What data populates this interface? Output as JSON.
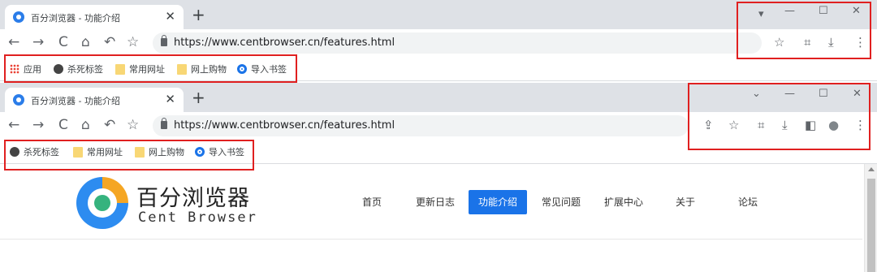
{
  "browser1": {
    "tab_title": "百分浏览器 - 功能介绍",
    "tab_close": "✕",
    "new_tab": "+",
    "window_buttons": {
      "tab_search": "▾",
      "minimize": "—",
      "maximize": "☐",
      "close": "✕"
    },
    "nav": {
      "back": "←",
      "forward": "→",
      "reload": "C",
      "home": "⌂",
      "undo": "↶",
      "star": "☆"
    },
    "url": "https://www.centbrowser.cn/features.html",
    "toolbar_icons": {
      "bookmark_star": "☆",
      "screenshot": "⌗",
      "download": "⤓",
      "menu": "⋮"
    },
    "bookmarks": [
      {
        "icon": "apps-icon",
        "label": "应用"
      },
      {
        "icon": "globe-icon",
        "label": "杀死标签"
      },
      {
        "icon": "folder-icon",
        "label": "常用网址"
      },
      {
        "icon": "folder-icon",
        "label": "网上购物"
      },
      {
        "icon": "gear-icon",
        "label": "导入书签"
      }
    ]
  },
  "browser2": {
    "tab_title": "百分浏览器 - 功能介绍",
    "tab_close": "✕",
    "new_tab": "+",
    "window_buttons": {
      "tab_search": "⌄",
      "minimize": "—",
      "maximize": "☐",
      "close": "✕"
    },
    "nav": {
      "back": "←",
      "forward": "→",
      "reload": "C",
      "home": "⌂",
      "undo": "↶",
      "star": "☆"
    },
    "url": "https://www.centbrowser.cn/features.html",
    "toolbar_icons": {
      "share": "⇪",
      "bookmark_star": "☆",
      "screenshot": "⌗",
      "download": "⤓",
      "side_panel": "◧",
      "profile": "●",
      "menu": "⋮"
    },
    "bookmarks": [
      {
        "icon": "globe-icon",
        "label": "杀死标签"
      },
      {
        "icon": "folder-icon",
        "label": "常用网址"
      },
      {
        "icon": "folder-icon",
        "label": "网上购物"
      },
      {
        "icon": "gear-icon",
        "label": "导入书签"
      }
    ]
  },
  "site": {
    "logo_cn": "百分浏览器",
    "logo_en": "Cent Browser",
    "nav": [
      "首页",
      "更新日志",
      "功能介绍",
      "常见问题",
      "扩展中心",
      "关于",
      "论坛"
    ],
    "active_nav": "功能介绍"
  },
  "colors": {
    "highlight_box": "#e02020",
    "tabstrip": "#dee1e6",
    "accent": "#1a73e8"
  }
}
